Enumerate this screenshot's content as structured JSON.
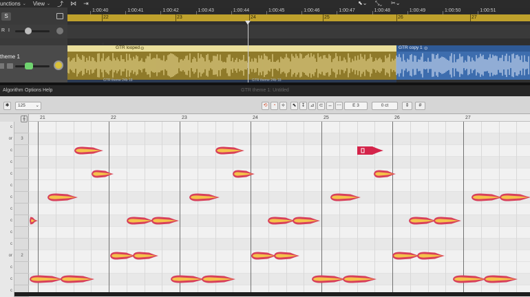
{
  "menubar": {
    "functions": "unctions",
    "view": "View",
    "chev": "⌄"
  },
  "ruler": {
    "times": [
      "1:00:40",
      "1:00:41",
      "1:00:42",
      "1:00:43",
      "1:00:44",
      "1:00:45",
      "1:00:46",
      "1:00:47",
      "1:00:48",
      "1:00:49",
      "1:00:50",
      "1:00:51"
    ],
    "bars": [
      "22",
      "23",
      "24",
      "25",
      "26",
      "27"
    ]
  },
  "tracks": {
    "solo_label": "S",
    "r_label": "R",
    "i_label": "I",
    "track1_name": "theme 1"
  },
  "regions": {
    "gold_label": "GTR looped",
    "blue_label": "GTR copy 1",
    "under_label_a": "GTR theme 24b 18",
    "under_label_b": "GTR theme 24b 18"
  },
  "editor": {
    "menu_algorithm": "Algorithm",
    "menu_options": "Options",
    "menu_help": "Help",
    "title": "GTR theme 1: Untitled",
    "zoom_value": "125",
    "pitch_field": "E 3",
    "cents_field": "0 ct"
  },
  "roll": {
    "bar_numbers": [
      "21",
      "22",
      "23",
      "24",
      "25",
      "26",
      "27"
    ],
    "octave_labels": [
      {
        "row": 1,
        "text": "3",
        "note": "or"
      },
      {
        "row": 11,
        "text": "2",
        "note": "or"
      }
    ],
    "note_glyph": "c"
  },
  "colors": {
    "bar_ruler": "#bfa12c",
    "region_gold": "#8f7a2a",
    "region_blue": "#3d6dae",
    "blob_outer": "#d8405a",
    "blob_inner": "#f5c24a",
    "blob_selected": "#d4244a"
  }
}
